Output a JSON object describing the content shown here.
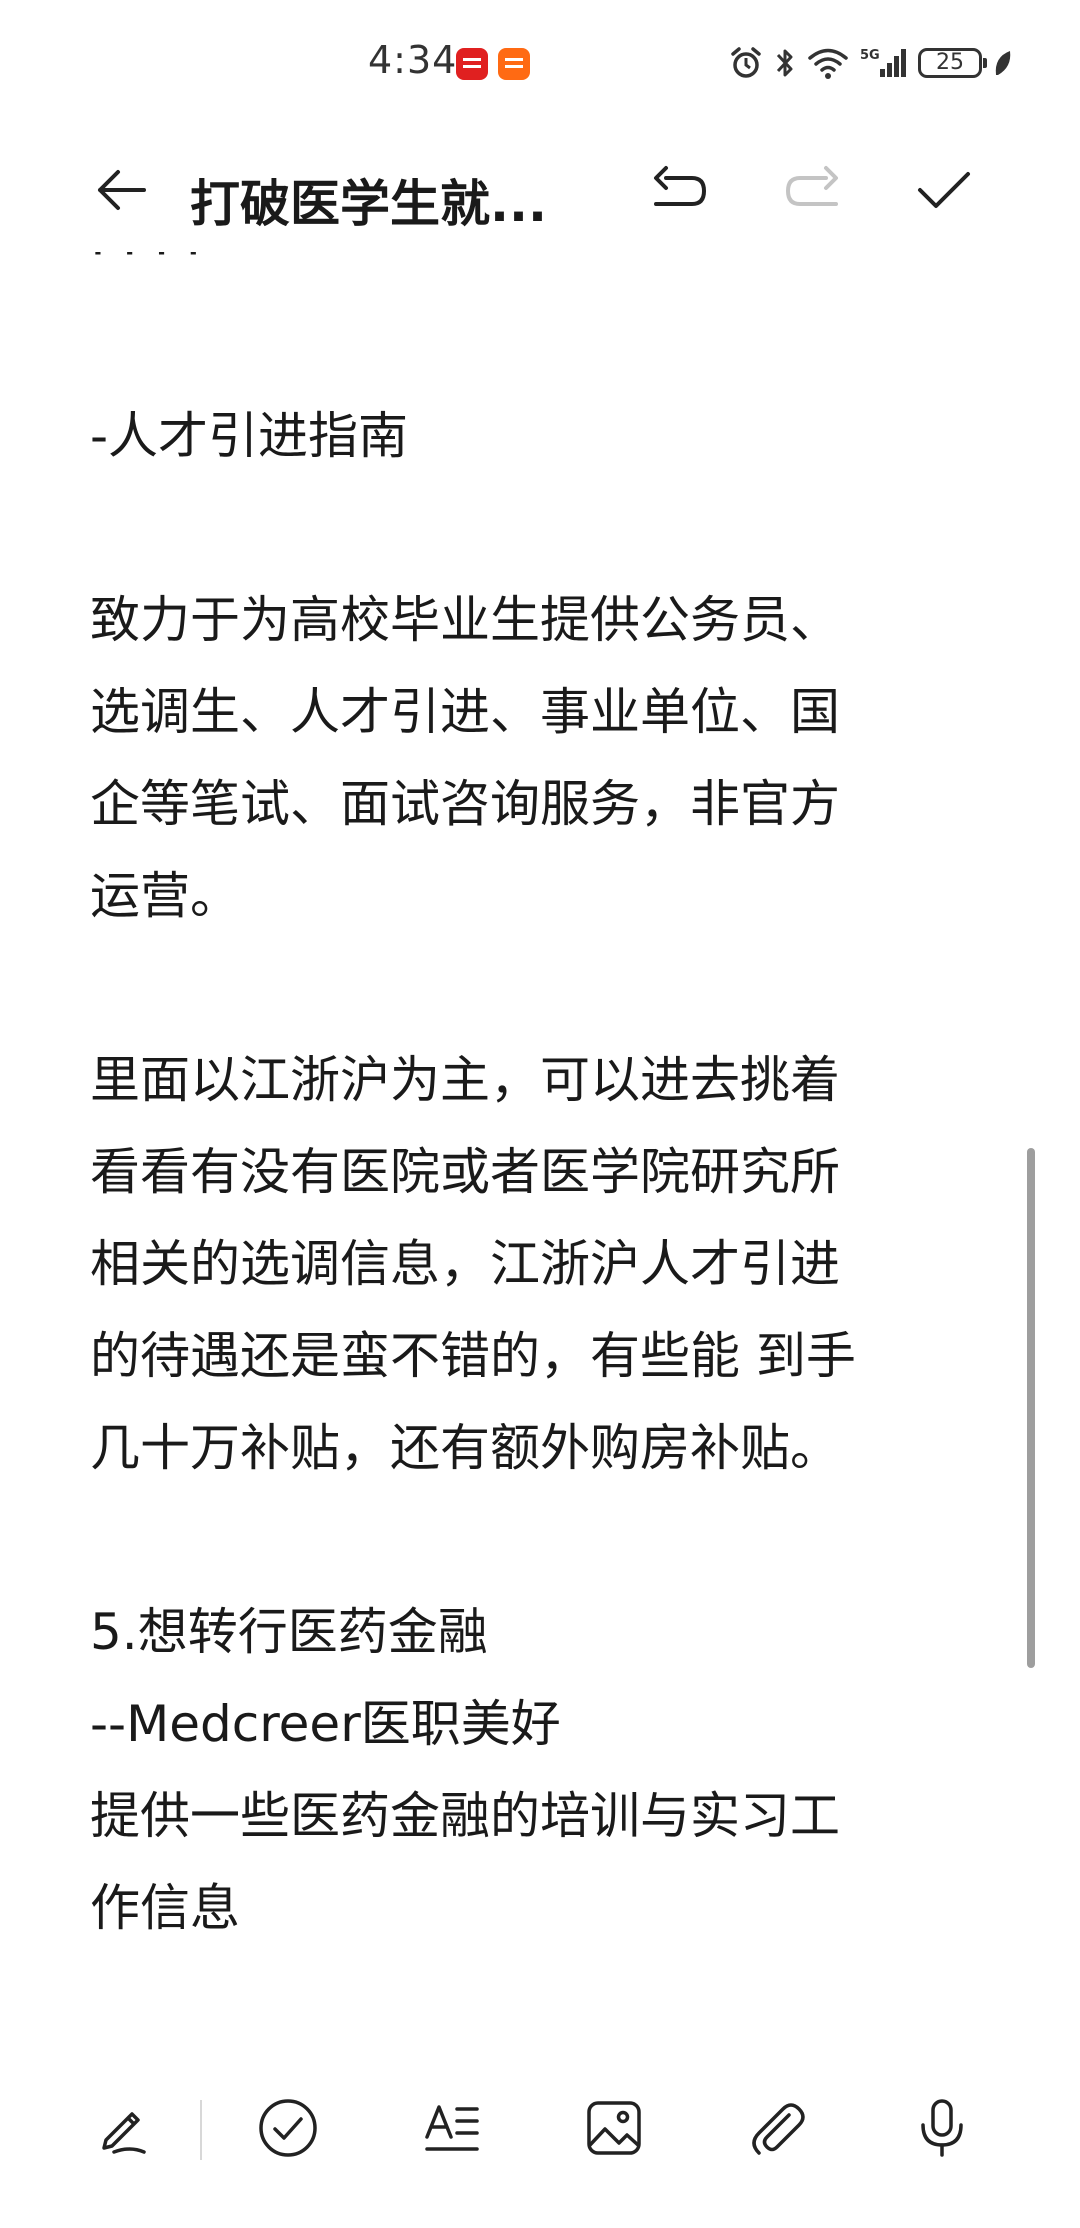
{
  "status_bar": {
    "time": "4:34",
    "network": "5G",
    "battery": "25"
  },
  "title_bar": {
    "title": "打破医学生就..."
  },
  "content": {
    "clipped_line": "·  ·  ·  ·",
    "paragraphs": [
      [
        "-人才引进指南"
      ],
      [
        "致力于为高校毕业生提供公务员、",
        "选调生、人才引进、事业单位、国",
        "企等笔试、面试咨询服务，非官方",
        "运营。"
      ],
      [
        "里面以江浙沪为主，可以进去挑着",
        "看看有没有医院或者医学院研究所",
        "相关的选调信息，江浙沪人才引进",
        "的待遇还是蛮不错的，有些能 到手",
        "几十万补贴，还有额外购房补贴。"
      ],
      [
        "5.想转行医药金融",
        "--Medcreer医职美好",
        "提供一些医药金融的培训与实习工",
        "作信息"
      ]
    ]
  },
  "colors": {
    "text": "#1a1a1a",
    "icon": "#333333",
    "disabled_icon": "#c4c4c4",
    "scrollbar": "#9e9e9e"
  }
}
